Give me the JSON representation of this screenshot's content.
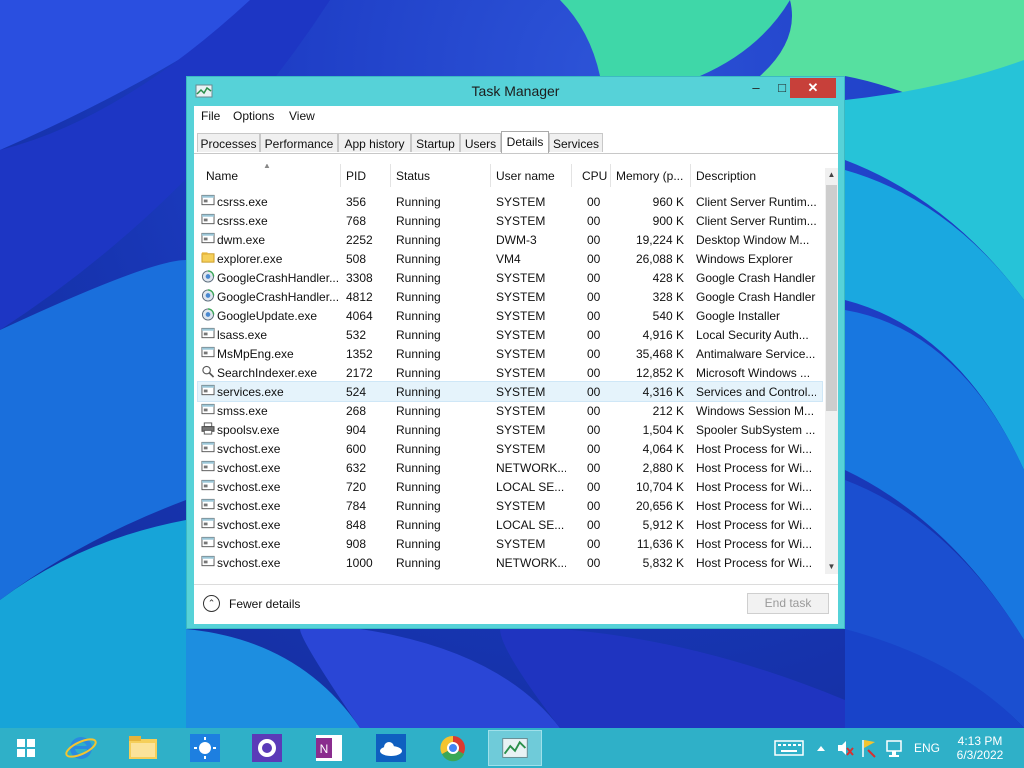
{
  "window": {
    "title": "Task Manager",
    "minimize": "–",
    "maximize": "□",
    "close": "✕"
  },
  "menu": [
    "File",
    "Options",
    "View"
  ],
  "tabs": [
    "Processes",
    "Performance",
    "App history",
    "Startup",
    "Users",
    "Details",
    "Services"
  ],
  "active_tab": "Details",
  "columns": [
    "Name",
    "PID",
    "Status",
    "User name",
    "CPU",
    "Memory (p...",
    "Description"
  ],
  "rows": [
    {
      "name": "csrss.exe",
      "pid": "356",
      "status": "Running",
      "user": "SYSTEM",
      "cpu": "00",
      "mem": "960 K",
      "desc": "Client Server Runtim...",
      "icon": "process-icon"
    },
    {
      "name": "csrss.exe",
      "pid": "768",
      "status": "Running",
      "user": "SYSTEM",
      "cpu": "00",
      "mem": "900 K",
      "desc": "Client Server Runtim...",
      "icon": "process-icon"
    },
    {
      "name": "dwm.exe",
      "pid": "2252",
      "status": "Running",
      "user": "DWM-3",
      "cpu": "00",
      "mem": "19,224 K",
      "desc": "Desktop Window M...",
      "icon": "process-icon"
    },
    {
      "name": "explorer.exe",
      "pid": "508",
      "status": "Running",
      "user": "VM4",
      "cpu": "00",
      "mem": "26,088 K",
      "desc": "Windows Explorer",
      "icon": "folder-icon"
    },
    {
      "name": "GoogleCrashHandler...",
      "pid": "3308",
      "status": "Running",
      "user": "SYSTEM",
      "cpu": "00",
      "mem": "428 K",
      "desc": "Google Crash Handler",
      "icon": "google-update-icon"
    },
    {
      "name": "GoogleCrashHandler...",
      "pid": "4812",
      "status": "Running",
      "user": "SYSTEM",
      "cpu": "00",
      "mem": "328 K",
      "desc": "Google Crash Handler",
      "icon": "google-update-icon"
    },
    {
      "name": "GoogleUpdate.exe",
      "pid": "4064",
      "status": "Running",
      "user": "SYSTEM",
      "cpu": "00",
      "mem": "540 K",
      "desc": "Google Installer",
      "icon": "google-update-icon"
    },
    {
      "name": "lsass.exe",
      "pid": "532",
      "status": "Running",
      "user": "SYSTEM",
      "cpu": "00",
      "mem": "4,916 K",
      "desc": "Local Security Auth...",
      "icon": "process-icon"
    },
    {
      "name": "MsMpEng.exe",
      "pid": "1352",
      "status": "Running",
      "user": "SYSTEM",
      "cpu": "00",
      "mem": "35,468 K",
      "desc": "Antimalware Service...",
      "icon": "process-icon"
    },
    {
      "name": "SearchIndexer.exe",
      "pid": "2172",
      "status": "Running",
      "user": "SYSTEM",
      "cpu": "00",
      "mem": "12,852 K",
      "desc": "Microsoft Windows ...",
      "icon": "search-indexer-icon"
    },
    {
      "name": "services.exe",
      "pid": "524",
      "status": "Running",
      "user": "SYSTEM",
      "cpu": "00",
      "mem": "4,316 K",
      "desc": "Services and Control...",
      "icon": "process-icon"
    },
    {
      "name": "smss.exe",
      "pid": "268",
      "status": "Running",
      "user": "SYSTEM",
      "cpu": "00",
      "mem": "212 K",
      "desc": "Windows Session M...",
      "icon": "process-icon"
    },
    {
      "name": "spoolsv.exe",
      "pid": "904",
      "status": "Running",
      "user": "SYSTEM",
      "cpu": "00",
      "mem": "1,504 K",
      "desc": "Spooler SubSystem ...",
      "icon": "printer-icon"
    },
    {
      "name": "svchost.exe",
      "pid": "600",
      "status": "Running",
      "user": "SYSTEM",
      "cpu": "00",
      "mem": "4,064 K",
      "desc": "Host Process for Wi...",
      "icon": "process-icon"
    },
    {
      "name": "svchost.exe",
      "pid": "632",
      "status": "Running",
      "user": "NETWORK...",
      "cpu": "00",
      "mem": "2,880 K",
      "desc": "Host Process for Wi...",
      "icon": "process-icon"
    },
    {
      "name": "svchost.exe",
      "pid": "720",
      "status": "Running",
      "user": "LOCAL SE...",
      "cpu": "00",
      "mem": "10,704 K",
      "desc": "Host Process for Wi...",
      "icon": "process-icon"
    },
    {
      "name": "svchost.exe",
      "pid": "784",
      "status": "Running",
      "user": "SYSTEM",
      "cpu": "00",
      "mem": "20,656 K",
      "desc": "Host Process for Wi...",
      "icon": "process-icon"
    },
    {
      "name": "svchost.exe",
      "pid": "848",
      "status": "Running",
      "user": "LOCAL SE...",
      "cpu": "00",
      "mem": "5,912 K",
      "desc": "Host Process for Wi...",
      "icon": "process-icon"
    },
    {
      "name": "svchost.exe",
      "pid": "908",
      "status": "Running",
      "user": "SYSTEM",
      "cpu": "00",
      "mem": "11,636 K",
      "desc": "Host Process for Wi...",
      "icon": "process-icon"
    },
    {
      "name": "svchost.exe",
      "pid": "1000",
      "status": "Running",
      "user": "NETWORK...",
      "cpu": "00",
      "mem": "5,832 K",
      "desc": "Host Process for Wi...",
      "icon": "process-icon"
    }
  ],
  "selected_row": "services.exe",
  "footer": {
    "fewer_details": "Fewer details",
    "end_task": "End task"
  },
  "taskbar": {
    "apps": [
      "start-icon",
      "internet-explorer-icon",
      "file-explorer-icon",
      "weather-icon",
      "settings-icon",
      "onenote-icon",
      "onedrive-icon",
      "chrome-icon",
      "task-manager-icon"
    ],
    "language": "ENG",
    "time": "4:13 PM",
    "date": "6/3/2022"
  },
  "colors": {
    "window_frame": "#56d2d8",
    "taskbar": "#2fb0c8",
    "close_button": "#c7403a",
    "selected_row": "#e5f3fb"
  }
}
